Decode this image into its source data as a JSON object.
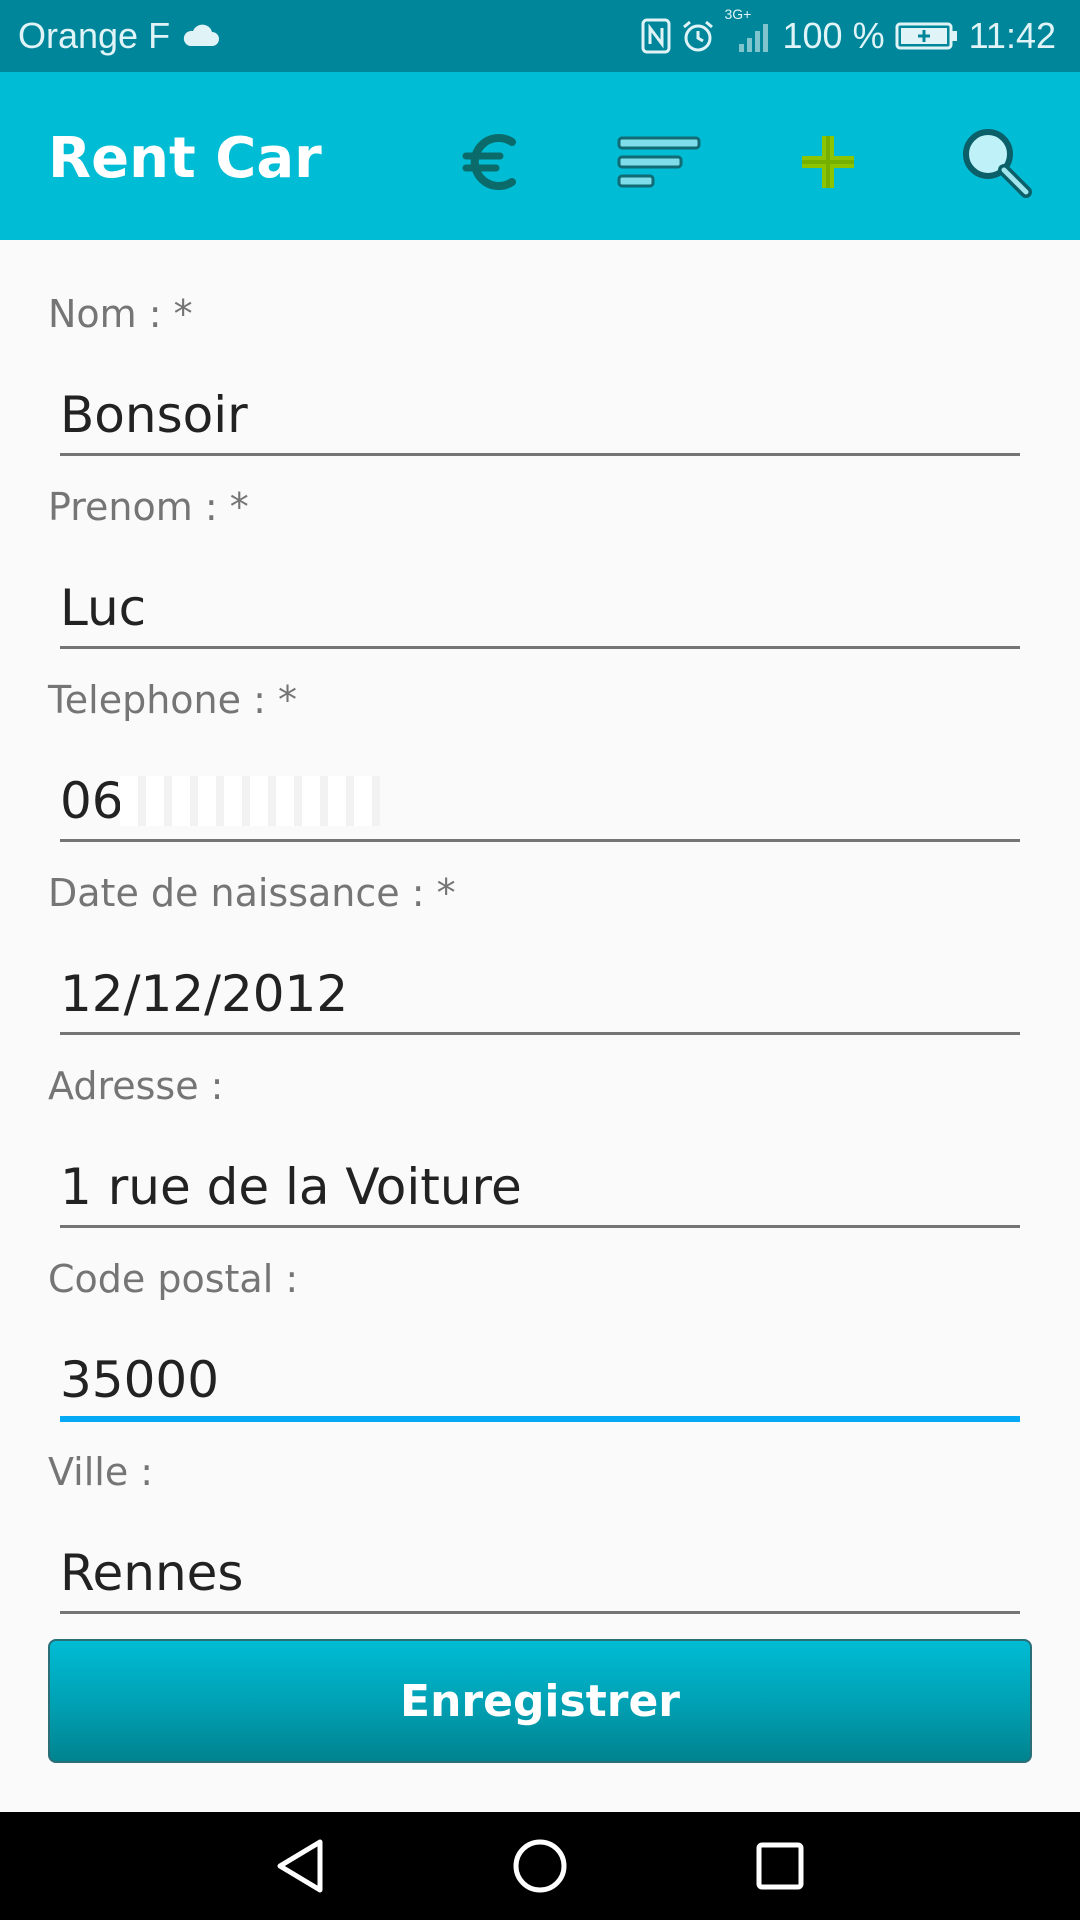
{
  "status_bar": {
    "carrier": "Orange F",
    "network": "3G+",
    "battery": "100 %",
    "time": "11:42",
    "icons": [
      "cloud-icon",
      "nfc-icon",
      "alarm-icon",
      "signal-icon",
      "battery-icon"
    ]
  },
  "app_bar": {
    "title": "Rent Car",
    "actions": [
      "euro-icon",
      "sort-icon",
      "add-icon",
      "search-icon"
    ],
    "background": "#00bcd4"
  },
  "form": {
    "fields": [
      {
        "label": "Nom : *",
        "value": "Bonsoir"
      },
      {
        "label": "Prenom : *",
        "value": "Luc"
      },
      {
        "label": "Telephone : *",
        "value": "06"
      },
      {
        "label": "Date de naissance : *",
        "value": "12/12/2012"
      },
      {
        "label": "Adresse :",
        "value": "1 rue de la Voiture"
      },
      {
        "label": "Code postal :",
        "value": "35000"
      },
      {
        "label": "Ville :",
        "value": "Rennes"
      }
    ],
    "focused_field": "Code postal :",
    "accent": "#03a9f4"
  },
  "save_button": {
    "label": "Enregistrer"
  },
  "nav_bar": {
    "buttons": [
      "back-icon",
      "home-icon",
      "recents-icon"
    ]
  }
}
